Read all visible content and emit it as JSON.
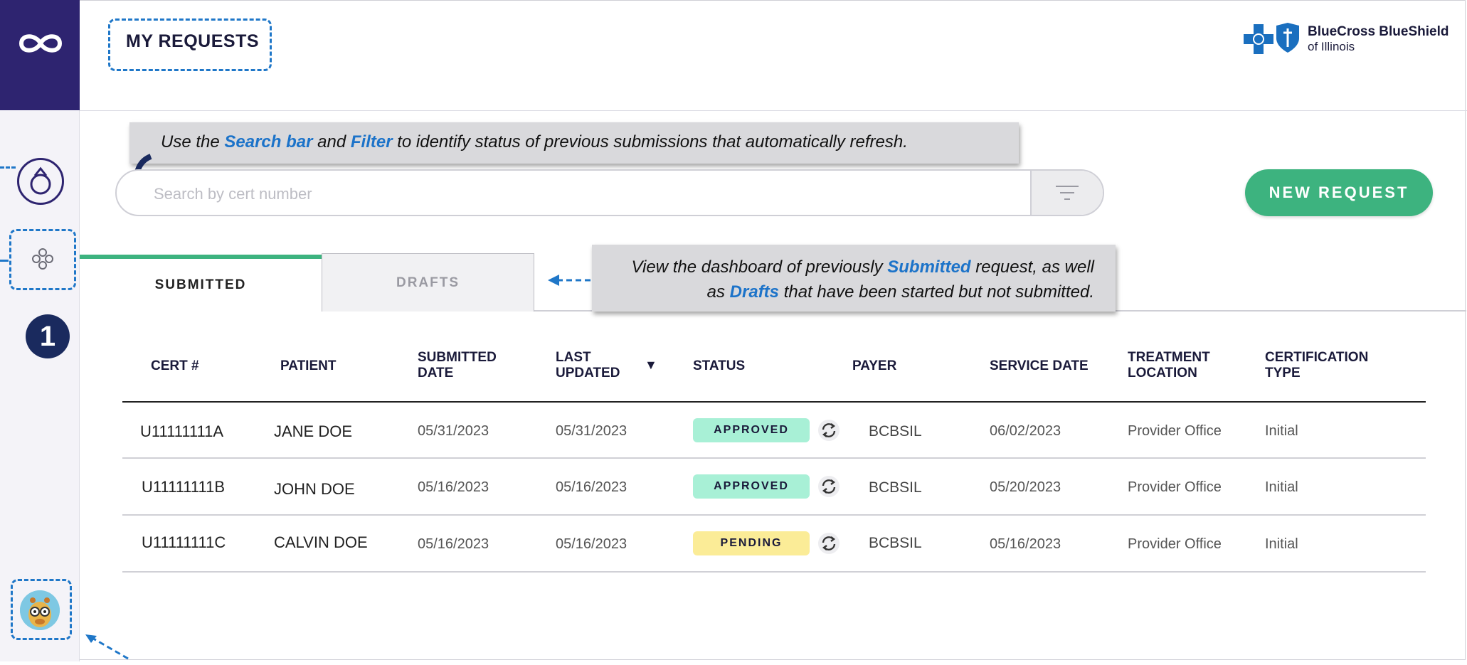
{
  "header": {
    "title": "MY REQUESTS"
  },
  "logo": {
    "line1": "BlueCross BlueShield",
    "line2": "of Illinois"
  },
  "sidebar": {
    "step_number": "1"
  },
  "callouts": {
    "search": {
      "p1": "Use the ",
      "h1": "Search bar",
      "p2": " and ",
      "h2": "Filter",
      "p3": " to identify status of previous submissions that automatically refresh."
    },
    "tabs": {
      "p1": "View the dashboard of previously ",
      "h1": "Submitted",
      "p2": " request, as well as ",
      "h2": "Drafts",
      "p3": " that have been started but not submitted."
    }
  },
  "search": {
    "placeholder": "Search by cert number"
  },
  "actions": {
    "new_request": "NEW REQUEST"
  },
  "tabs": [
    {
      "label": "SUBMITTED",
      "active": true
    },
    {
      "label": "DRAFTS",
      "active": false
    }
  ],
  "table": {
    "columns": {
      "cert": "CERT #",
      "patient": "PATIENT",
      "submitted_date": "SUBMITTED DATE",
      "last_updated": "LAST UPDATED",
      "sort_indicator": "▼",
      "status": "STATUS",
      "payer": "PAYER",
      "service_date": "SERVICE DATE",
      "treatment_location": "TREATMENT LOCATION",
      "certification_type": "CERTIFICATION TYPE"
    },
    "rows": [
      {
        "cert": "U11111111A",
        "patient": "JANE DOE",
        "submitted": "05/31/2023",
        "updated": "05/31/2023",
        "status": "APPROVED",
        "payer": "BCBSIL",
        "service": "06/02/2023",
        "location": "Provider Office",
        "type": "Initial"
      },
      {
        "cert": "U11111111B",
        "patient": "JOHN DOE",
        "submitted": "05/16/2023",
        "updated": "05/16/2023",
        "status": "APPROVED",
        "payer": "BCBSIL",
        "service": "05/20/2023",
        "location": "Provider Office",
        "type": "Initial"
      },
      {
        "cert": "U11111111C",
        "patient": "CALVIN DOE",
        "submitted": "05/16/2023",
        "updated": "05/16/2023",
        "status": "PENDING",
        "payer": "BCBSIL",
        "service": "05/16/2023",
        "location": "Provider Office",
        "type": "Initial"
      }
    ]
  },
  "colors": {
    "brand": "#2e2470",
    "accent_green": "#3db37f",
    "approved_bg": "#a8f0d6",
    "pending_bg": "#fbec97",
    "highlight_blue": "#1c73c9",
    "annotation_blue": "#1f77c8"
  },
  "icons": [
    "infinity-logo-icon",
    "user-icon",
    "apps-icon",
    "filter-icon",
    "refresh-icon",
    "bcbs-cross-icon",
    "bcbs-shield-icon",
    "avatar"
  ]
}
